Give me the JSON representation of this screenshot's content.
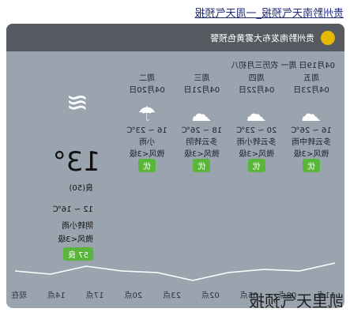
{
  "headline": "贵州黔南天气预报_一周天气预报",
  "banner": "贵州黔南发布大雾黄色预警",
  "date_line": "04月19日 周一 农历三月初八",
  "today": {
    "temp": "13°",
    "air": "良(50)",
    "range": "12 ~ 16℃",
    "desc": "阴转小雨",
    "wind": "微风<3级",
    "aqi_badge": "57 良"
  },
  "days": [
    {
      "name": "周五",
      "date": "04月23日",
      "range": "16 ~ 26℃",
      "desc": "多云转中雨",
      "wind": "微风<3级",
      "badge": "优"
    },
    {
      "name": "周四",
      "date": "04月22日",
      "range": "20 ~ 23℃",
      "desc": "多云转小雨",
      "wind": "微风<3级",
      "badge": "优"
    },
    {
      "name": "周三",
      "date": "04月21日",
      "range": "18 ~ 26℃",
      "desc": "多云转阴",
      "wind": "微风<3级",
      "badge": "优"
    },
    {
      "name": "周二",
      "date": "04月20日",
      "range": "16 ~ 23℃",
      "desc": "小雨",
      "wind": "微风<3级",
      "badge": "优"
    }
  ],
  "hours": [
    "11点",
    "08点",
    "05点",
    "02点",
    "23点",
    "20点",
    "17点",
    "14点",
    "现在"
  ],
  "watermark": "凯里天气预报"
}
